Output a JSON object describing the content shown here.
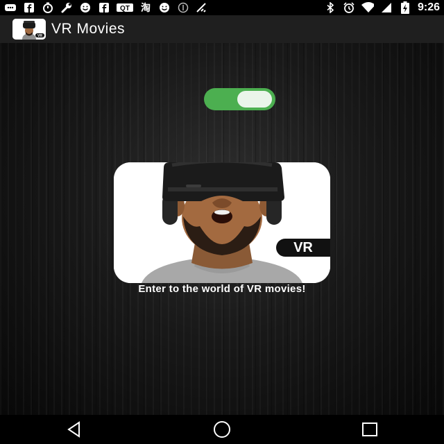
{
  "status_bar": {
    "time": "9:26",
    "left_icons": [
      "message-icon",
      "facebook-icon",
      "timer-icon",
      "wrench-icon",
      "smiley-icon",
      "facebook-icon",
      "qt-icon",
      "taobao-icon",
      "smiley-icon",
      "cancel-circle-icon",
      "no-signal-icon"
    ],
    "qt_label": "QT",
    "taobao_label": "淘",
    "right_icons": [
      "bluetooth-icon",
      "alarm-icon",
      "wifi-icon",
      "signal-icon",
      "battery-charging-icon"
    ]
  },
  "app_bar": {
    "title": "VR Movies",
    "app_icon": "vr-headset-app-icon",
    "app_icon_badge": "VR"
  },
  "main": {
    "toggle_state": "on",
    "toggle_color": "#4caf50",
    "card_badge": "VR",
    "card_image": "man-wearing-vr-headset",
    "tagline": "Enter to the world of VR movies!"
  },
  "nav_bar": {
    "buttons": [
      "back-icon",
      "home-icon",
      "recents-icon"
    ]
  }
}
